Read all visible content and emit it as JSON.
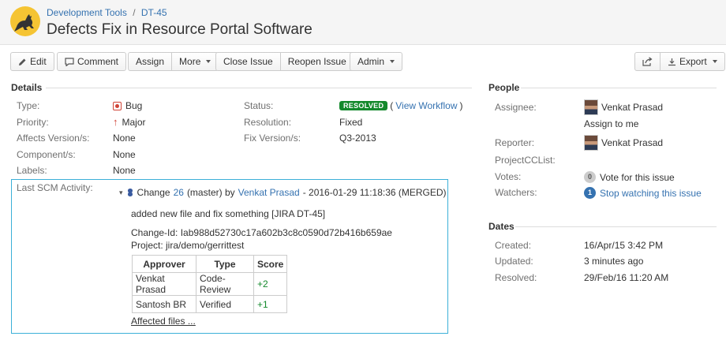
{
  "breadcrumb": {
    "project": "Development Tools",
    "separator": "/",
    "issue_key": "DT-45"
  },
  "title": "Defects Fix in Resource Portal Software",
  "toolbar": {
    "edit": "Edit",
    "comment": "Comment",
    "assign": "Assign",
    "more": "More",
    "close_issue": "Close Issue",
    "reopen_issue": "Reopen Issue",
    "admin": "Admin",
    "export": "Export"
  },
  "details": {
    "heading": "Details",
    "type_label": "Type:",
    "type_value": "Bug",
    "priority_label": "Priority:",
    "priority_value": "Major",
    "affects_label": "Affects Version/s:",
    "affects_value": "None",
    "component_label": "Component/s:",
    "component_value": "None",
    "labels_label": "Labels:",
    "labels_value": "None",
    "status_label": "Status:",
    "status_value": "RESOLVED",
    "view_workflow": "View Workflow",
    "resolution_label": "Resolution:",
    "resolution_value": "Fixed",
    "fix_label": "Fix Version/s:",
    "fix_value": "Q3-2013"
  },
  "scm": {
    "label": "Last SCM Activity:",
    "change_word": "Change",
    "change_number": "26",
    "branch": "(master) by",
    "author": "Venkat Prasad",
    "meta": "- 2016-01-29 11:18:36 (MERGED)",
    "message": "added new file and fix something [JIRA DT-45]",
    "change_id": "Change-Id: Iab988d52730c17a602b3c8c0590d72b416b659ae",
    "project": "Project: jira/demo/gerrittest",
    "headers": [
      "Approver",
      "Type",
      "Score"
    ],
    "rows": [
      [
        "Venkat Prasad",
        "Code-Review",
        "+2"
      ],
      [
        "Santosh BR",
        "Verified",
        "+1"
      ]
    ],
    "affected_files": "Affected files ..."
  },
  "people": {
    "heading": "People",
    "assignee_label": "Assignee:",
    "assignee_value": "Venkat Prasad",
    "assign_to_me": "Assign to me",
    "reporter_label": "Reporter:",
    "reporter_value": "Venkat Prasad",
    "cclist_label": "ProjectCCList:",
    "votes_label": "Votes:",
    "votes_count": "0",
    "votes_action": "Vote for this issue",
    "watchers_label": "Watchers:",
    "watchers_count": "1",
    "watchers_action": "Stop watching this issue"
  },
  "dates": {
    "heading": "Dates",
    "created_label": "Created:",
    "created_value": "16/Apr/15 3:42 PM",
    "updated_label": "Updated:",
    "updated_value": "3 minutes ago",
    "resolved_label": "Resolved:",
    "resolved_value": "29/Feb/16 11:20 AM"
  },
  "colors": {
    "link": "#3572b0",
    "resolved": "#14892c",
    "scm_border": "#3cb0d8",
    "logo": "#f5c433"
  },
  "icons": {
    "logo": "kangaroo-logo",
    "edit": "pencil-icon",
    "comment": "comment-icon",
    "share": "share-icon",
    "export": "export-icon",
    "bug": "bug-icon",
    "priority": "arrow-up-icon",
    "scm": "gerrit-icon"
  }
}
